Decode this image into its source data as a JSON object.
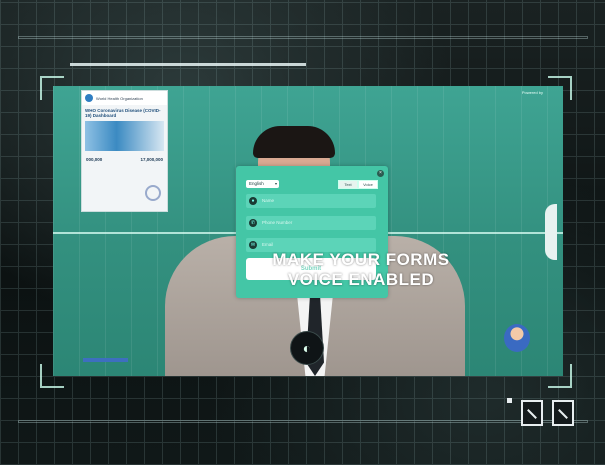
{
  "thumbnail": {
    "org_name": "World Health Organization",
    "title": "WHO Coronavirus Disease (COVID-19) Dashboard",
    "stat_left": "000,000",
    "stat_right": "17,000,000"
  },
  "form": {
    "language": "English",
    "toggle_left": "Text",
    "toggle_right": "Voice",
    "fields": [
      {
        "placeholder": "Name",
        "icon": "user-icon"
      },
      {
        "placeholder": "Phone Number",
        "icon": "phone-icon"
      },
      {
        "placeholder": "Email",
        "icon": "email-icon"
      }
    ],
    "submit_label": "Submit"
  },
  "powered_by": "Powered by",
  "headline": {
    "line1": "MAKE YOUR FORMS",
    "line2": "VOICE ENABLED"
  },
  "colors": {
    "teal": "#3fa493",
    "panel": "#44c6a6",
    "field": "#5cd4b8"
  }
}
